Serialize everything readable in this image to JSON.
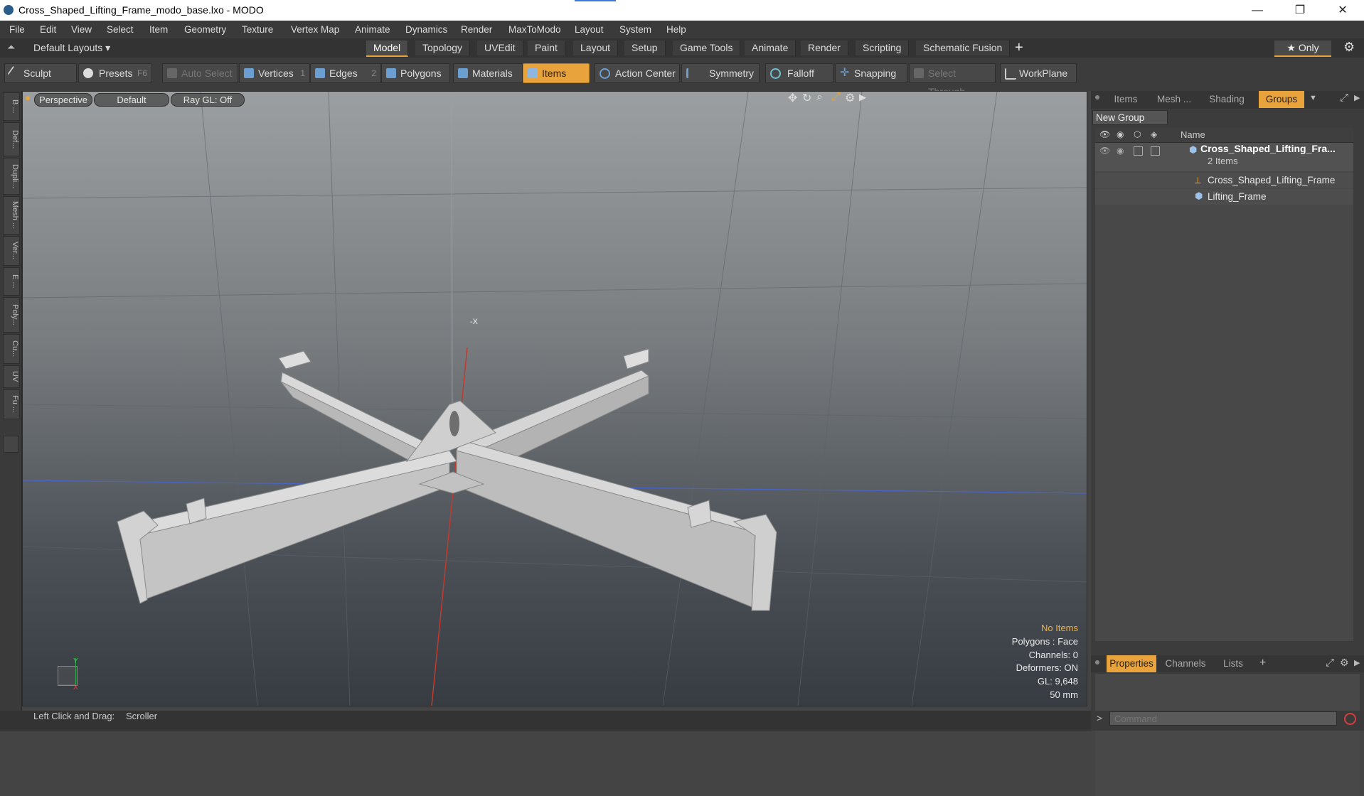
{
  "window": {
    "title": "Cross_Shaped_Lifting_Frame_modo_base.lxo - MODO",
    "minimize": "—",
    "maximize": "❐",
    "close": "✕"
  },
  "menu": [
    "File",
    "Edit",
    "View",
    "Select",
    "Item",
    "Geometry",
    "Texture",
    "Vertex Map",
    "Animate",
    "Dynamics",
    "Render",
    "MaxToModo",
    "Layout",
    "System",
    "Help"
  ],
  "layout_row": {
    "layouts_dropdown": "Default Layouts ▾",
    "tabs": [
      "Model",
      "Topology",
      "UVEdit",
      "Paint",
      "Layout",
      "Setup",
      "Game Tools",
      "Animate",
      "Render",
      "Scripting",
      "Schematic Fusion"
    ],
    "add": "+",
    "only_label": "★  Only",
    "gear": "⚙"
  },
  "toolbar": {
    "sculpt": "Sculpt",
    "presets": "Presets",
    "presets_key": "F6",
    "auto_select": "Auto Select",
    "vertices": "Vertices",
    "vertices_count": "1",
    "edges": "Edges",
    "edges_count": "2",
    "polygons": "Polygons",
    "materials": "Materials",
    "items": "Items",
    "action_center": "Action Center",
    "symmetry": "Symmetry",
    "falloff": "Falloff",
    "snapping": "Snapping",
    "select_through": "Select Through",
    "workplane": "WorkPlane"
  },
  "left_tabs": [
    "B ...",
    "Def...",
    "Dupli...",
    "Mesh ...",
    "Ver...",
    "E ...",
    "Poly...",
    "Cu...",
    "UV",
    "Fu ..."
  ],
  "viewport": {
    "view_mode": "Perspective",
    "shading": "Default",
    "raygl": "Ray GL: Off",
    "axis_label": "-X",
    "gizmo_y": "Y",
    "gizmo_x": "X",
    "info": {
      "no_items": "No Items",
      "polygons": "Polygons : Face",
      "channels": "Channels: 0",
      "deformers": "Deformers: ON",
      "gl": "GL: 9,648",
      "scale": "50 mm"
    }
  },
  "right_panel": {
    "tabs": [
      "Items",
      "Mesh ...",
      "Shading",
      "Groups"
    ],
    "new_group": "New Group",
    "col_name": "Name",
    "group_name": "Cross_Shaped_Lifting_Fra...",
    "group_count": "2 Items",
    "children": [
      "Cross_Shaped_Lifting_Frame",
      "Lifting_Frame"
    ],
    "bottom_tabs": [
      "Properties",
      "Channels",
      "Lists"
    ],
    "add": "+"
  },
  "status": {
    "hint": "Left Click and Drag:",
    "action": "Scroller",
    "command_placeholder": "Command",
    "prompt": ">"
  },
  "colors": {
    "accent": "#e8a33c",
    "accent_text": "#f0b040"
  }
}
